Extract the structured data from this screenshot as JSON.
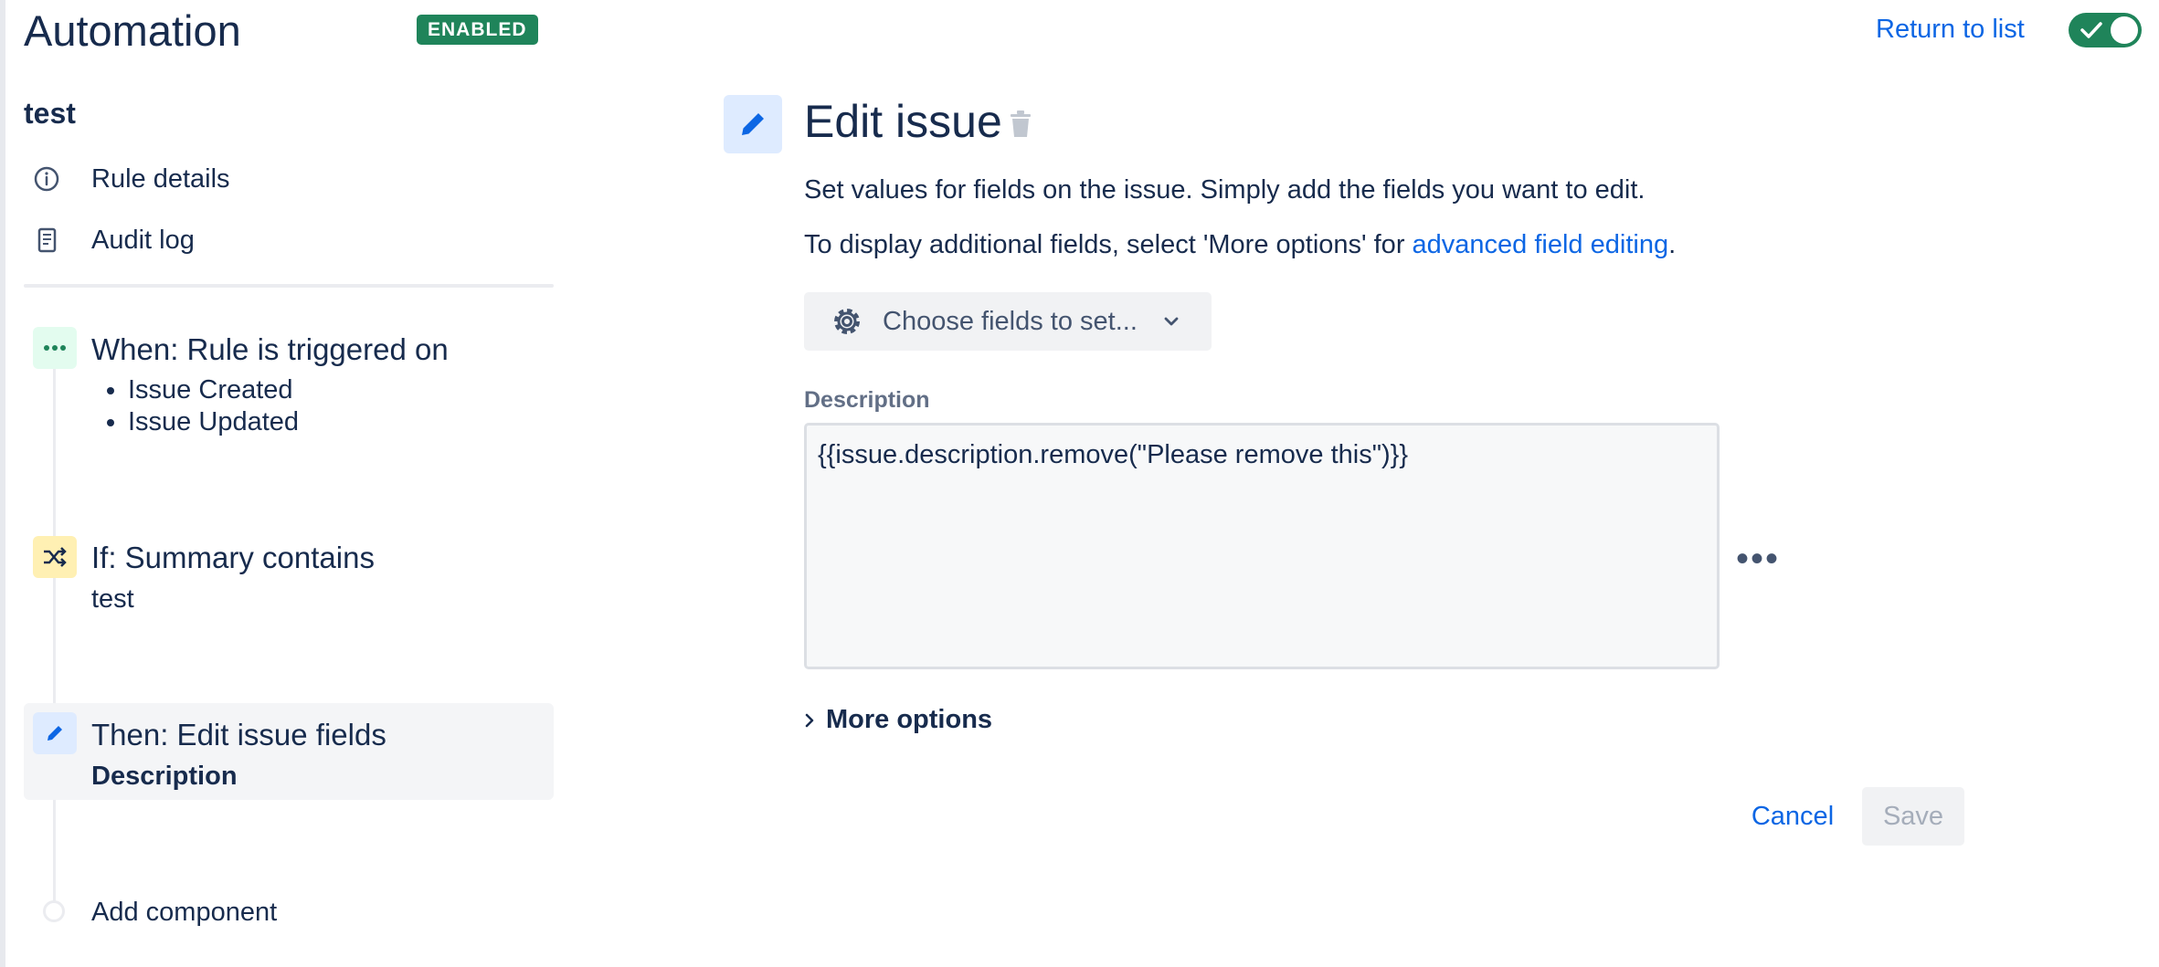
{
  "header": {
    "title": "Automation",
    "status_badge": "ENABLED",
    "return_link": "Return to list"
  },
  "sidebar": {
    "rule_name": "test",
    "links": [
      {
        "label": "Rule details",
        "icon": "info-icon"
      },
      {
        "label": "Audit log",
        "icon": "audit-log-icon"
      }
    ],
    "components": [
      {
        "title": "When: Rule is triggered on",
        "items": [
          "Issue Created",
          "Issue Updated"
        ],
        "icon": "more-dots-icon",
        "color": "#e3fcef"
      },
      {
        "title": "If: Summary contains",
        "detail": "test",
        "icon": "shuffle-icon",
        "color": "#fff0b3"
      },
      {
        "title": "Then: Edit issue fields",
        "detail": "Description",
        "icon": "pencil-icon",
        "color": "#deebff"
      }
    ],
    "add_component": "Add component"
  },
  "main": {
    "title": "Edit issue",
    "description": "Set values for fields on the issue. Simply add the fields you want to edit.",
    "advanced_text": "To display additional fields, select 'More options' for ",
    "advanced_link": "advanced field editing",
    "advanced_end": ".",
    "choose_fields": "Choose fields to set...",
    "field_label": "Description",
    "field_value": "{{issue.description.remove(\"Please remove this\")}}",
    "more_options": "More options",
    "cancel": "Cancel",
    "save": "Save"
  },
  "colors": {
    "accent": "#0c66e4",
    "enabled_green": "#1f845a"
  }
}
